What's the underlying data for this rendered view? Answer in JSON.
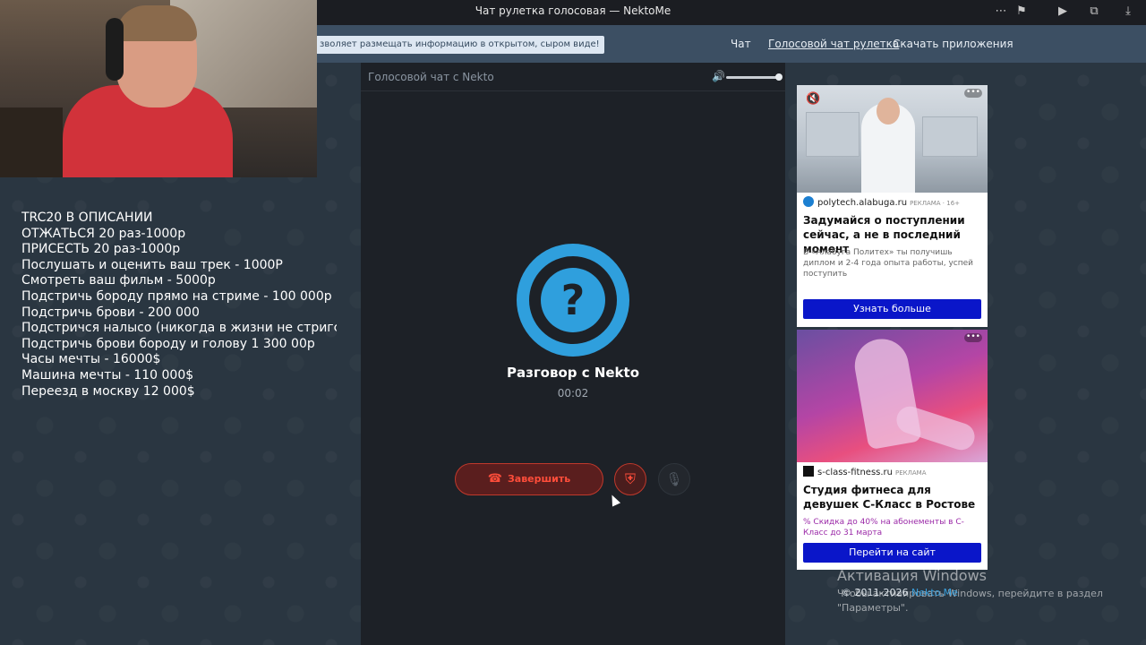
{
  "browser": {
    "title": "Чат рулетка голосовая — NektoMe",
    "icons": [
      "more-icon",
      "bookmark-icon",
      "play-icon",
      "extensions-icon",
      "download-icon"
    ]
  },
  "header": {
    "notice": "зволяет размещать информацию в открытом, сыром виде!",
    "nav": [
      "Чат",
      "Голосовой чат рулетка",
      "Скачать приложения"
    ]
  },
  "stream_overlay": {
    "lines": [
      "TRC20 В ОПИСАНИИ",
      "ОТЖАТЬСЯ 20 раз-1000р",
      "ПРИСЕСТЬ 20 раз-1000р",
      "Послушать и оценить ваш трек - 1000Р",
      "Смотреть ваш фильм - 5000р",
      "Подстричь бороду прямо на стриме - 100 000р",
      "Подстричь брови - 200 000",
      "Подстричся налысо (никогда в жизни не стригся н",
      "Подстричь брови бороду и голову 1 300 00р",
      "Часы мечты - 16000$",
      "Машина мечты - 110 000$",
      "Переезд в москву 12 000$"
    ]
  },
  "call": {
    "header": "Голосовой чат с Nekto",
    "volume": 1.0,
    "avatar_symbol": "?",
    "name": "Разговор с Nekto",
    "timer": "00:02",
    "end_label": "Завершить",
    "accent": "#2f9fdd",
    "danger": "#ff4d3a"
  },
  "ads": [
    {
      "domain": "polytech.alabuga.ru",
      "tag": "РЕКЛАМА · 16+",
      "headline": "Задумайся о поступлении сейчас, а не в последний момент",
      "description": "В «Алабуга Политех» ты получишь диплом и 2-4 года опыта работы, успей поступить",
      "cta": "Узнать больше"
    },
    {
      "domain": "s-class-fitness.ru",
      "tag": "РЕКЛАМА",
      "headline": "Студия фитнеса для девушек С-Класс в Ростове",
      "promo": "Скидка до 40% на абонементы в С-Класс до 31 марта",
      "cta": "Перейти на сайт"
    }
  ],
  "footer": {
    "windows_title": "Активация Windows",
    "windows_text_1": "Чтобы активировать Windows, перейдите в раздел",
    "windows_text_2": "\"Параметры\".",
    "copyright": "© 2011-2026",
    "brand": "Nekto.Me"
  }
}
